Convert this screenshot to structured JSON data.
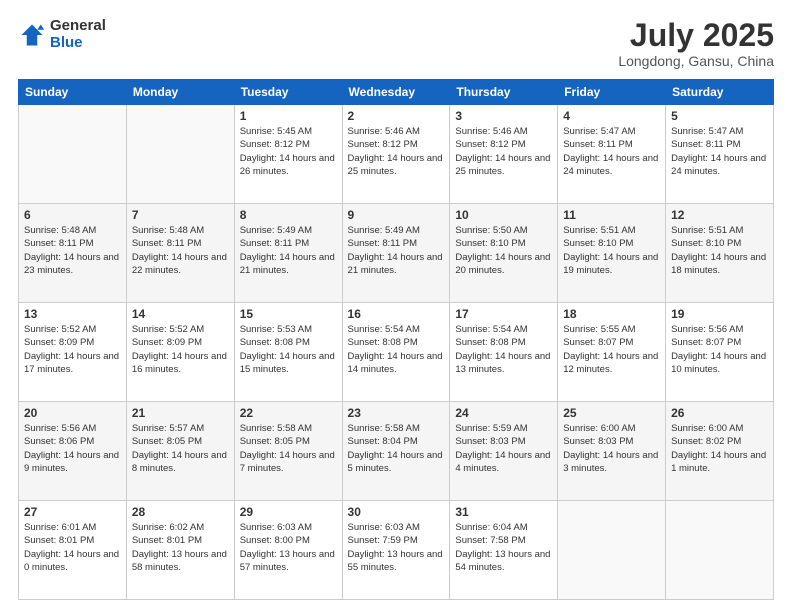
{
  "logo": {
    "general": "General",
    "blue": "Blue"
  },
  "title": "July 2025",
  "subtitle": "Longdong, Gansu, China",
  "days_header": [
    "Sunday",
    "Monday",
    "Tuesday",
    "Wednesday",
    "Thursday",
    "Friday",
    "Saturday"
  ],
  "weeks": [
    [
      {
        "day": "",
        "info": ""
      },
      {
        "day": "",
        "info": ""
      },
      {
        "day": "1",
        "info": "Sunrise: 5:45 AM\nSunset: 8:12 PM\nDaylight: 14 hours and 26 minutes."
      },
      {
        "day": "2",
        "info": "Sunrise: 5:46 AM\nSunset: 8:12 PM\nDaylight: 14 hours and 25 minutes."
      },
      {
        "day": "3",
        "info": "Sunrise: 5:46 AM\nSunset: 8:12 PM\nDaylight: 14 hours and 25 minutes."
      },
      {
        "day": "4",
        "info": "Sunrise: 5:47 AM\nSunset: 8:11 PM\nDaylight: 14 hours and 24 minutes."
      },
      {
        "day": "5",
        "info": "Sunrise: 5:47 AM\nSunset: 8:11 PM\nDaylight: 14 hours and 24 minutes."
      }
    ],
    [
      {
        "day": "6",
        "info": "Sunrise: 5:48 AM\nSunset: 8:11 PM\nDaylight: 14 hours and 23 minutes."
      },
      {
        "day": "7",
        "info": "Sunrise: 5:48 AM\nSunset: 8:11 PM\nDaylight: 14 hours and 22 minutes."
      },
      {
        "day": "8",
        "info": "Sunrise: 5:49 AM\nSunset: 8:11 PM\nDaylight: 14 hours and 21 minutes."
      },
      {
        "day": "9",
        "info": "Sunrise: 5:49 AM\nSunset: 8:11 PM\nDaylight: 14 hours and 21 minutes."
      },
      {
        "day": "10",
        "info": "Sunrise: 5:50 AM\nSunset: 8:10 PM\nDaylight: 14 hours and 20 minutes."
      },
      {
        "day": "11",
        "info": "Sunrise: 5:51 AM\nSunset: 8:10 PM\nDaylight: 14 hours and 19 minutes."
      },
      {
        "day": "12",
        "info": "Sunrise: 5:51 AM\nSunset: 8:10 PM\nDaylight: 14 hours and 18 minutes."
      }
    ],
    [
      {
        "day": "13",
        "info": "Sunrise: 5:52 AM\nSunset: 8:09 PM\nDaylight: 14 hours and 17 minutes."
      },
      {
        "day": "14",
        "info": "Sunrise: 5:52 AM\nSunset: 8:09 PM\nDaylight: 14 hours and 16 minutes."
      },
      {
        "day": "15",
        "info": "Sunrise: 5:53 AM\nSunset: 8:08 PM\nDaylight: 14 hours and 15 minutes."
      },
      {
        "day": "16",
        "info": "Sunrise: 5:54 AM\nSunset: 8:08 PM\nDaylight: 14 hours and 14 minutes."
      },
      {
        "day": "17",
        "info": "Sunrise: 5:54 AM\nSunset: 8:08 PM\nDaylight: 14 hours and 13 minutes."
      },
      {
        "day": "18",
        "info": "Sunrise: 5:55 AM\nSunset: 8:07 PM\nDaylight: 14 hours and 12 minutes."
      },
      {
        "day": "19",
        "info": "Sunrise: 5:56 AM\nSunset: 8:07 PM\nDaylight: 14 hours and 10 minutes."
      }
    ],
    [
      {
        "day": "20",
        "info": "Sunrise: 5:56 AM\nSunset: 8:06 PM\nDaylight: 14 hours and 9 minutes."
      },
      {
        "day": "21",
        "info": "Sunrise: 5:57 AM\nSunset: 8:05 PM\nDaylight: 14 hours and 8 minutes."
      },
      {
        "day": "22",
        "info": "Sunrise: 5:58 AM\nSunset: 8:05 PM\nDaylight: 14 hours and 7 minutes."
      },
      {
        "day": "23",
        "info": "Sunrise: 5:58 AM\nSunset: 8:04 PM\nDaylight: 14 hours and 5 minutes."
      },
      {
        "day": "24",
        "info": "Sunrise: 5:59 AM\nSunset: 8:03 PM\nDaylight: 14 hours and 4 minutes."
      },
      {
        "day": "25",
        "info": "Sunrise: 6:00 AM\nSunset: 8:03 PM\nDaylight: 14 hours and 3 minutes."
      },
      {
        "day": "26",
        "info": "Sunrise: 6:00 AM\nSunset: 8:02 PM\nDaylight: 14 hours and 1 minute."
      }
    ],
    [
      {
        "day": "27",
        "info": "Sunrise: 6:01 AM\nSunset: 8:01 PM\nDaylight: 14 hours and 0 minutes."
      },
      {
        "day": "28",
        "info": "Sunrise: 6:02 AM\nSunset: 8:01 PM\nDaylight: 13 hours and 58 minutes."
      },
      {
        "day": "29",
        "info": "Sunrise: 6:03 AM\nSunset: 8:00 PM\nDaylight: 13 hours and 57 minutes."
      },
      {
        "day": "30",
        "info": "Sunrise: 6:03 AM\nSunset: 7:59 PM\nDaylight: 13 hours and 55 minutes."
      },
      {
        "day": "31",
        "info": "Sunrise: 6:04 AM\nSunset: 7:58 PM\nDaylight: 13 hours and 54 minutes."
      },
      {
        "day": "",
        "info": ""
      },
      {
        "day": "",
        "info": ""
      }
    ]
  ]
}
